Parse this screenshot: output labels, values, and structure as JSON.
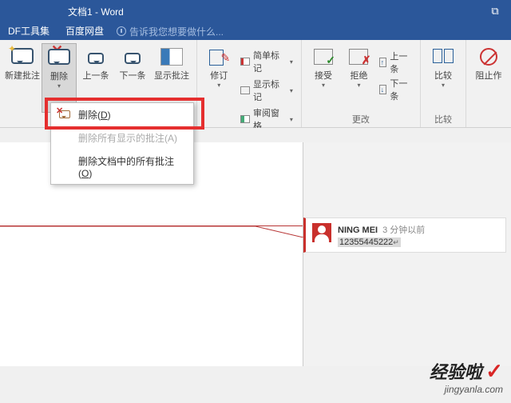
{
  "title_bar": {
    "doc_title": "文档1 - Word",
    "restore_icon": "⧉"
  },
  "tabs": {
    "pdf_tool": "DF工具集",
    "baidu": "百度网盘",
    "hint": "告诉我您想要做什么..."
  },
  "ribbon": {
    "comments_group": {
      "new": "新建批注",
      "delete": "删除",
      "prev": "上一条",
      "next": "下一条",
      "show": "显示批注"
    },
    "revision_group": {
      "label": "修订",
      "revise": "修订",
      "simple_markup": "简单标记",
      "show_markup": "显示标记",
      "review_pane": "审阅窗格"
    },
    "change_group": {
      "label": "更改",
      "accept": "接受",
      "reject": "拒绝",
      "prev": "上一条",
      "next": "下一条"
    },
    "compare_group": {
      "label": "比较",
      "compare": "比较"
    },
    "protect_group": {
      "block": "阻止作"
    }
  },
  "menu": {
    "delete": "删除(",
    "delete_key": "D",
    "delete_close": ")",
    "delete_shown_disabled": "删除所有显示的批注(A)",
    "delete_all": "删除文档中的所有批注(",
    "delete_all_key": "O",
    "delete_all_close": ")"
  },
  "comment": {
    "author": "NING MEI",
    "time": "3 分钟以前",
    "text": "12355445222"
  },
  "watermark": {
    "main": "经验啦",
    "sub": "jingyanla.com"
  }
}
